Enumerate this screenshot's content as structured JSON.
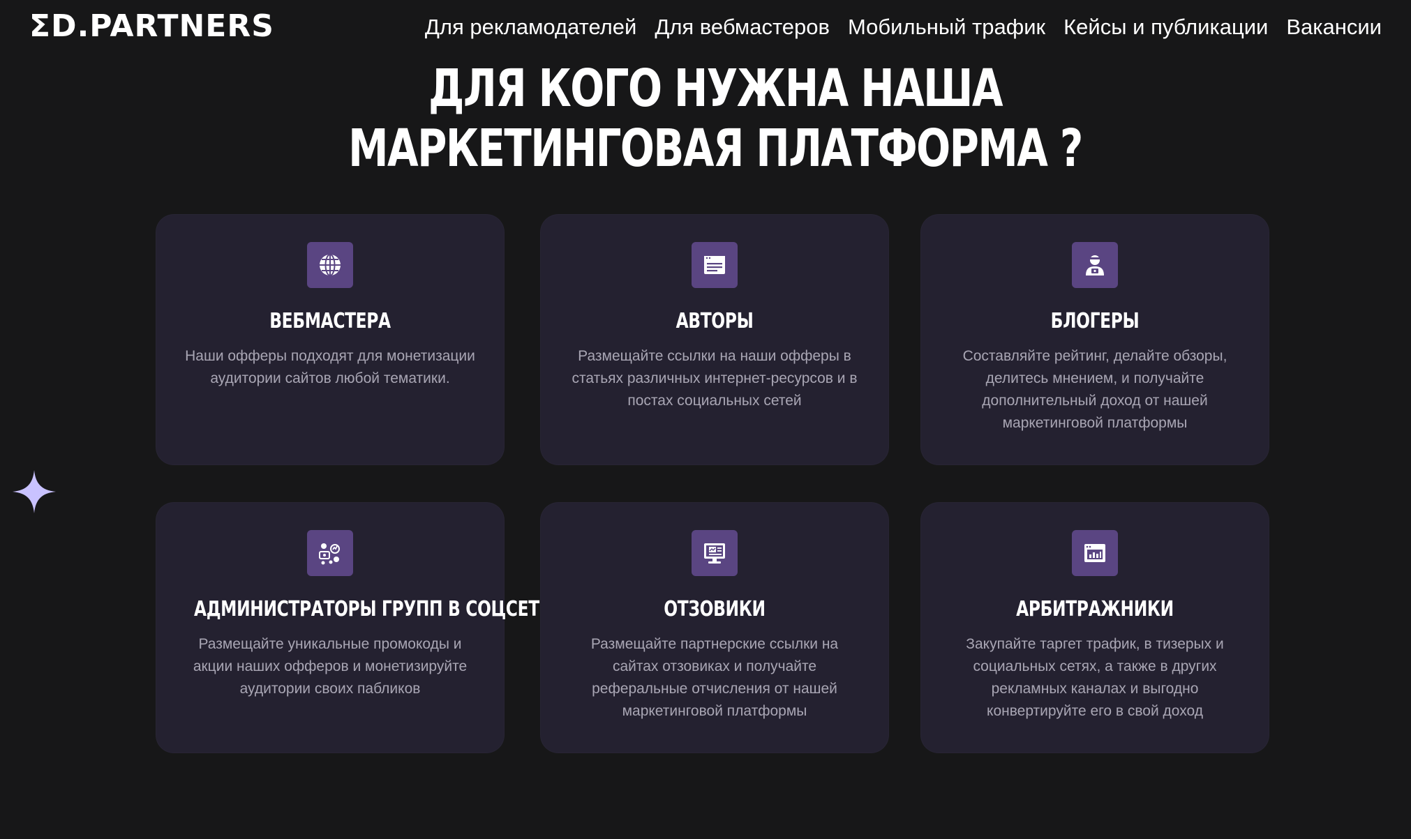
{
  "header": {
    "logo": "ΣD.PARTNERS",
    "nav": [
      {
        "label": "Для рекламодателей"
      },
      {
        "label": "Для вебмастеров"
      },
      {
        "label": "Мобильный трафик"
      },
      {
        "label": "Кейсы и публикации"
      },
      {
        "label": "Вакансии"
      }
    ]
  },
  "main": {
    "title_line1": "ДЛЯ КОГО НУЖНА НАША",
    "title_line2": "МАРКЕТИНГОВАЯ ПЛАТФОРМА ?",
    "cards": [
      {
        "icon": "globe-icon",
        "title": "ВЕБМАСТЕРА",
        "text": "Наши офферы подходят для монетизации аудитории сайтов любой тематики."
      },
      {
        "icon": "article-icon",
        "title": "АВТОРЫ",
        "text": "Размещайте ссылки на наши офферы в статьях различных интернет-ресурсов и в постах социальных сетей"
      },
      {
        "icon": "blogger-icon",
        "title": "БЛОГЕРЫ",
        "text": "Составляйте рейтинг, делайте обзоры, делитесь мнением, и получайте дополнительный доход от нашей маркетинговой платформы"
      },
      {
        "icon": "social-groups-icon",
        "title": "АДМИНИСТРАТОРЫ ГРУПП В СОЦСЕТЯХ",
        "text": "Размещайте уникальные промокоды и акции наших офферов и монетизируйте аудитории своих пабликов"
      },
      {
        "icon": "review-monitor-icon",
        "title": "ОТЗОВИКИ",
        "text": "Размещайте партнерские ссылки на сайтах отзовиках и получайте реферальные отчисления от нашей маркетинговой платформы"
      },
      {
        "icon": "chart-window-icon",
        "title": "АРБИТРАЖНИКИ",
        "text": "Закупайте таргет трафик, в тизерых и социальных сетях, а также в других рекламных каналах и выгодно конвертируйте его в свой доход"
      }
    ]
  },
  "colors": {
    "background": "#171718",
    "card": "#242130",
    "icon_bg": "#5a4582",
    "accent_star": "#c9c2ff",
    "card_text": "#a9a6b4"
  }
}
